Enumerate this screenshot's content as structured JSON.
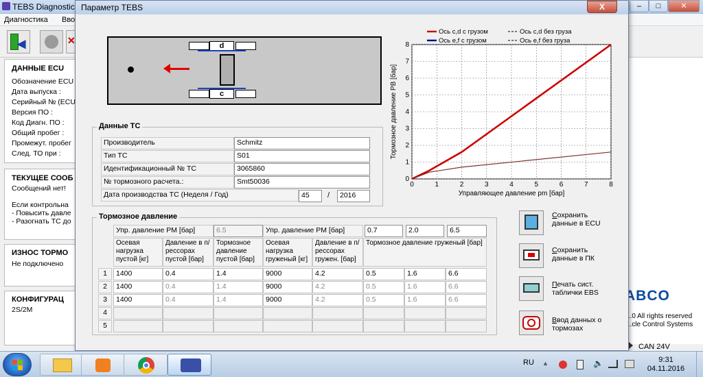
{
  "app": {
    "title": "TEBS Diagnostic",
    "menu": [
      "Диагностика",
      "Вво"
    ],
    "right_text": [
      "...0 All rights reserved",
      "...cle Control Systems"
    ],
    "brand": "ABCO",
    "can_status": "CAN 24V"
  },
  "ecu": {
    "heading": "ДАННЫЕ ECU",
    "fields": [
      "Обозначение ECU",
      "Дата выпуска :",
      "Серийный № (ECU",
      "Версия ПО :",
      "Код Диагн. ПО :",
      "Общий пробег :",
      "Промежут. пробег",
      "След. ТО при :"
    ]
  },
  "current": {
    "heading": "ТЕКУЩЕЕ СООБ",
    "lines": [
      "Сообщений нет!",
      "",
      "Если контрольна",
      "- Повысить давле",
      "- Разогнать ТС до"
    ]
  },
  "wear": {
    "heading": "ИЗНОС ТОРМО",
    "value": "Не подключено"
  },
  "config": {
    "heading": "КОНФИГУРАЦ",
    "value": "2S/2M"
  },
  "dialog": {
    "title": "Параметр TEBS",
    "close": "X"
  },
  "diagram": {
    "axle_top": "d",
    "axle_bottom": "c"
  },
  "vehicle": {
    "group_title": "Данные ТС",
    "rows": [
      {
        "label": "Производитель",
        "value": "Schmitz"
      },
      {
        "label": "Тип ТС",
        "value": "S01"
      },
      {
        "label": "Идентификационный № ТС",
        "value": "3065860"
      },
      {
        "label": "№ тормозного расчета.:",
        "value": "Smt50036"
      }
    ],
    "date_label": "Дата производства ТС (Неделя / Год)",
    "week": "45",
    "sep": "/",
    "year": "2016"
  },
  "brake": {
    "group_title": "Тормозное давление",
    "pm_label_1": "Упр. давление PM [бар]",
    "pm_value_1": "6.5",
    "pm_label_2": "Упр. давление PM [бар]",
    "pm_values_2": [
      "0.7",
      "2.0",
      "6.5"
    ],
    "headers": [
      "Осевая нагрузка пустой [кг]",
      "Давление  в п/рессорах пустой [бар]",
      "Тормозное давление пустой [бар]",
      "Осевая нагрузка груженый [кг]",
      "Давление в п/рессорах гружен. [бар]",
      "Тормозное давление груженый [бар]"
    ],
    "row_numbers": [
      "1",
      "2",
      "3",
      "4",
      "5"
    ],
    "rows": [
      [
        "1400",
        "0.4",
        "1.4",
        "9000",
        "4.2",
        "0.5",
        "1.6",
        "6.6"
      ],
      [
        "1400",
        "0.4",
        "1.4",
        "9000",
        "4.2",
        "0.5",
        "1.6",
        "6.6"
      ],
      [
        "1400",
        "0.4",
        "1.4",
        "9000",
        "4.2",
        "0.5",
        "1.6",
        "6.6"
      ]
    ]
  },
  "actions": [
    {
      "label_u": "С",
      "label": "охранить данные в ECU"
    },
    {
      "label_u": "С",
      "label": "охранить данные в ПК"
    },
    {
      "label_u": "П",
      "label": "ечать сист. таблички EBS"
    },
    {
      "label_u": "В",
      "label": "вод данных о тормозах"
    }
  ],
  "taskbar": {
    "lang": "RU",
    "time": "9:31",
    "date": "04.11.2016"
  },
  "chart_data": {
    "type": "line",
    "xlabel": "Управляющее давление pm [бар]",
    "ylabel": "Тормозное давление PB [бар]",
    "xlim": [
      0,
      8
    ],
    "ylim": [
      0,
      8
    ],
    "xticks": [
      0,
      1,
      2,
      3,
      4,
      5,
      6,
      7,
      8
    ],
    "yticks": [
      0,
      1,
      2,
      3,
      4,
      5,
      6,
      7,
      8
    ],
    "grid": true,
    "legend_position": "top",
    "series": [
      {
        "name": "Ось c,d с грузом",
        "color": "#cc0000",
        "style": "solid",
        "x": [
          0,
          0.7,
          2,
          8
        ],
        "y": [
          0,
          0.5,
          1.6,
          8
        ]
      },
      {
        "name": "Ось c,d без груза",
        "color": "#000000",
        "style": "dashed",
        "x": [],
        "y": []
      },
      {
        "name": "Ось e,f с грузом",
        "color": "#000080",
        "style": "solid",
        "x": [],
        "y": []
      },
      {
        "name": "Ось e,f без груза",
        "color": "#000000",
        "style": "dashed",
        "x": [],
        "y": []
      },
      {
        "name": "",
        "color": "#7a3030",
        "style": "solid",
        "x": [
          0,
          0.7,
          2,
          8
        ],
        "y": [
          0,
          0.4,
          0.7,
          1.6
        ]
      }
    ]
  }
}
